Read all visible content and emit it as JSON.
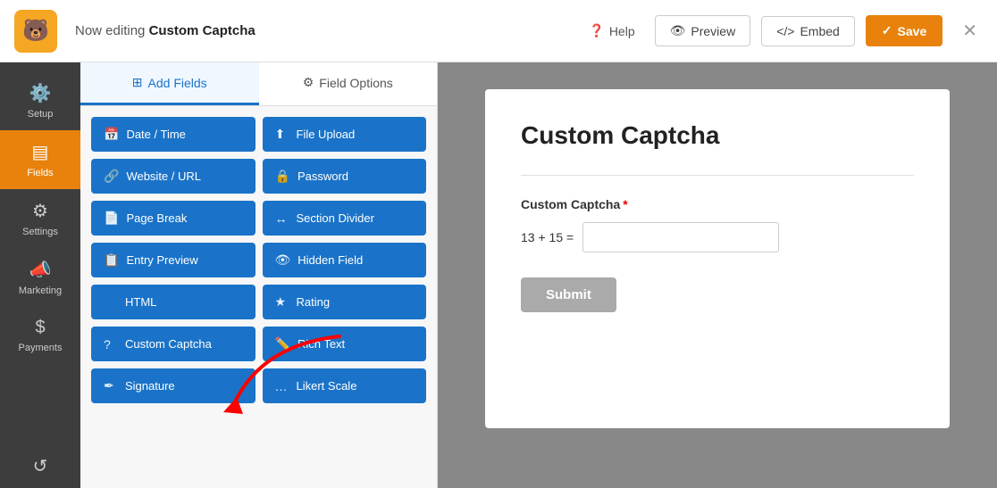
{
  "topbar": {
    "editing_prefix": "Now editing",
    "form_name": "Custom Captcha",
    "help_label": "Help",
    "preview_label": "Preview",
    "embed_label": "Embed",
    "save_label": "Save",
    "logo_emoji": "🐻"
  },
  "sidebar": {
    "items": [
      {
        "id": "setup",
        "label": "Setup",
        "icon": "⚙️"
      },
      {
        "id": "fields",
        "label": "Fields",
        "icon": "▤",
        "active": true
      },
      {
        "id": "settings",
        "label": "Settings",
        "icon": "⚙"
      },
      {
        "id": "marketing",
        "label": "Marketing",
        "icon": "📣"
      },
      {
        "id": "payments",
        "label": "Payments",
        "icon": "$"
      }
    ],
    "bottom_item": {
      "id": "revisions",
      "label": "",
      "icon": "↺"
    }
  },
  "fields_panel": {
    "tabs": [
      {
        "id": "add-fields",
        "label": "Add Fields",
        "active": true,
        "icon": "⊞"
      },
      {
        "id": "field-options",
        "label": "Field Options",
        "active": false,
        "icon": "⚙"
      }
    ],
    "buttons": [
      {
        "id": "date-time",
        "label": "Date / Time",
        "icon": "📅"
      },
      {
        "id": "file-upload",
        "label": "File Upload",
        "icon": "⬆"
      },
      {
        "id": "website-url",
        "label": "Website / URL",
        "icon": "🔗"
      },
      {
        "id": "password",
        "label": "Password",
        "icon": "🔒"
      },
      {
        "id": "page-break",
        "label": "Page Break",
        "icon": "📄"
      },
      {
        "id": "section-divider",
        "label": "Section Divider",
        "icon": "↔"
      },
      {
        "id": "entry-preview",
        "label": "Entry Preview",
        "icon": "📋"
      },
      {
        "id": "hidden-field",
        "label": "Hidden Field",
        "icon": "👁"
      },
      {
        "id": "html",
        "label": "HTML",
        "icon": "</>"
      },
      {
        "id": "rating",
        "label": "Rating",
        "icon": "★"
      },
      {
        "id": "custom-captcha",
        "label": "Custom Captcha",
        "icon": "?"
      },
      {
        "id": "rich-text",
        "label": "Rich Text",
        "icon": "✏️"
      },
      {
        "id": "signature",
        "label": "Signature",
        "icon": "✒"
      },
      {
        "id": "likert-scale",
        "label": "Likert Scale",
        "icon": "…"
      }
    ]
  },
  "form_preview": {
    "title": "Custom Captcha",
    "field_label": "Custom Captcha",
    "captcha_equation": "13 + 15 =",
    "captcha_input_value": "",
    "submit_label": "Submit"
  }
}
